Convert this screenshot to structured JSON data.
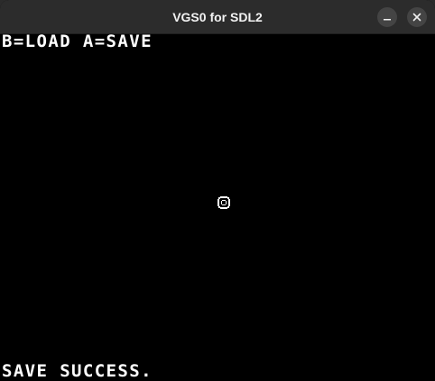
{
  "window": {
    "title": "VGS0 for SDL2",
    "minimize_icon": "minimize-icon",
    "close_icon": "close-icon"
  },
  "screen": {
    "top_message": "B=LOAD A=SAVE",
    "bottom_message": "SAVE SUCCESS.",
    "cursor_icon": "ring-sprite-icon"
  },
  "colors": {
    "titlebar": "#2c2c2c",
    "screen_background": "#000000",
    "text": "#ffffff"
  }
}
